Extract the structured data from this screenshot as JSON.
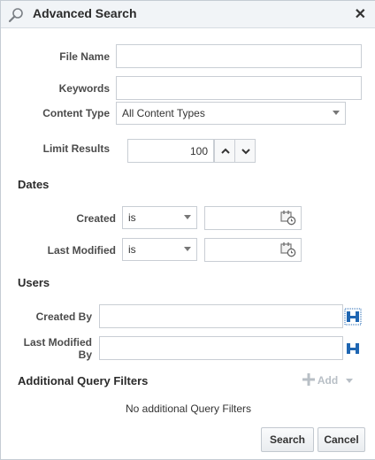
{
  "dialog": {
    "title": "Advanced Search",
    "close_glyph": "✕"
  },
  "fields": {
    "file_name": {
      "label": "File Name",
      "value": ""
    },
    "keywords": {
      "label": "Keywords",
      "value": ""
    },
    "content_type": {
      "label": "Content Type",
      "value": "All Content Types"
    },
    "limit_results": {
      "label": "Limit Results",
      "value": "100"
    }
  },
  "dates": {
    "heading": "Dates",
    "created": {
      "label": "Created",
      "operator": "is",
      "value": ""
    },
    "last_modified": {
      "label": "Last Modified",
      "operator": "is",
      "value": ""
    }
  },
  "users": {
    "heading": "Users",
    "created_by": {
      "label": "Created By",
      "value": ""
    },
    "last_modified_by": {
      "label_line1": "Last Modified",
      "label_line2": "By",
      "value": ""
    }
  },
  "query_filters": {
    "heading": "Additional Query Filters",
    "add_label": "Add",
    "empty_text": "No additional Query Filters"
  },
  "buttons": {
    "search": "Search",
    "cancel": "Cancel"
  },
  "colors": {
    "accent": "#1f66b2",
    "disabled": "#b8bfc6"
  },
  "icons": [
    "search-icon",
    "close-icon",
    "chevron-up-icon",
    "chevron-down-icon",
    "calendar-icon",
    "user-search-icon",
    "plus-icon",
    "caret-down-icon"
  ]
}
